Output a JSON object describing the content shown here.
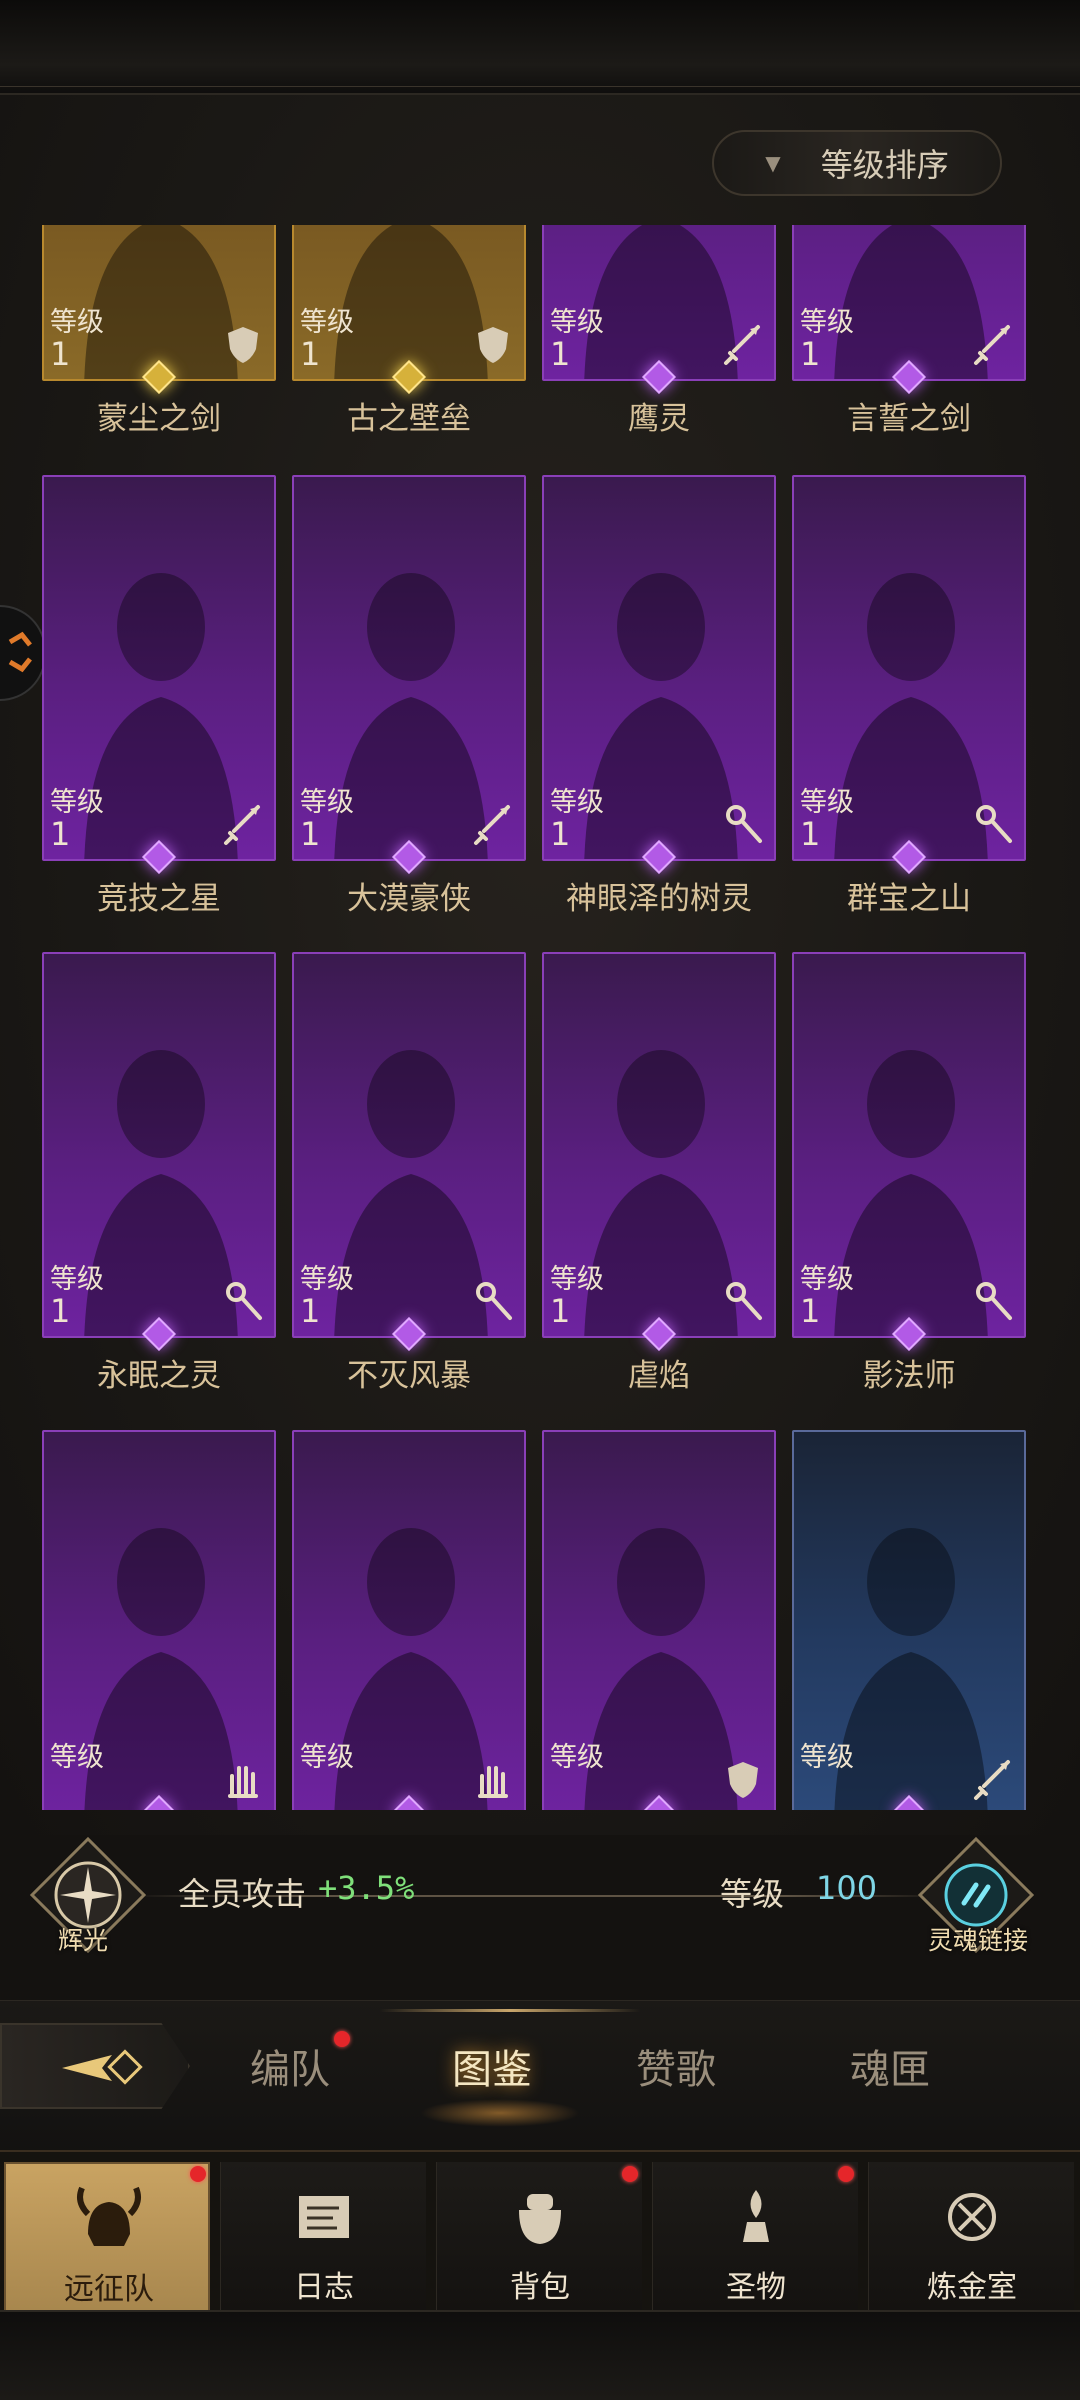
{
  "header": {
    "sort_label": "等级排序"
  },
  "level_label": "等级",
  "heroes": [
    {
      "name": "蒙尘之剑",
      "level": "1",
      "rarity": "gold",
      "class_icon": "shield-icon"
    },
    {
      "name": "古之壁垒",
      "level": "1",
      "rarity": "gold",
      "class_icon": "shield-icon"
    },
    {
      "name": "鹰灵",
      "level": "1",
      "rarity": "purple",
      "class_icon": "sword-icon"
    },
    {
      "name": "言誓之剑",
      "level": "1",
      "rarity": "purple",
      "class_icon": "sword-icon"
    },
    {
      "name": "竞技之星",
      "level": "1",
      "rarity": "purple",
      "class_icon": "sword-icon"
    },
    {
      "name": "大漠豪侠",
      "level": "1",
      "rarity": "purple",
      "class_icon": "sword-icon"
    },
    {
      "name": "神眼泽的树灵",
      "level": "1",
      "rarity": "purple",
      "class_icon": "staff-icon"
    },
    {
      "name": "群宝之山",
      "level": "1",
      "rarity": "purple",
      "class_icon": "staff-icon"
    },
    {
      "name": "永眠之灵",
      "level": "1",
      "rarity": "purple",
      "class_icon": "staff-icon"
    },
    {
      "name": "不灭风暴",
      "level": "1",
      "rarity": "purple",
      "class_icon": "staff-icon"
    },
    {
      "name": "虐焰",
      "level": "1",
      "rarity": "purple",
      "class_icon": "staff-icon"
    },
    {
      "name": "影法师",
      "level": "1",
      "rarity": "purple",
      "class_icon": "staff-icon"
    },
    {
      "name": "",
      "level": "",
      "rarity": "purple",
      "class_icon": "hand-icon"
    },
    {
      "name": "",
      "level": "",
      "rarity": "purple",
      "class_icon": "hand-icon"
    },
    {
      "name": "",
      "level": "",
      "rarity": "purple",
      "class_icon": "shield-icon"
    },
    {
      "name": "",
      "level": "",
      "rarity": "blue",
      "class_icon": "sword-icon"
    }
  ],
  "bonus": {
    "left_emblem_label": "辉光",
    "text": "全员攻击",
    "value": "+3.5%",
    "level_label": "等级",
    "level_value": "100",
    "right_emblem_label": "灵魂链接"
  },
  "tabs": [
    {
      "label": "编队",
      "active": false,
      "dot": true
    },
    {
      "label": "图鉴",
      "active": true,
      "dot": false
    },
    {
      "label": "赞歌",
      "active": false,
      "dot": false
    },
    {
      "label": "魂匣",
      "active": false,
      "dot": false
    }
  ],
  "nav": [
    {
      "label": "远征队",
      "icon": "helmet-icon",
      "active": true,
      "dot": true
    },
    {
      "label": "日志",
      "icon": "scroll-icon",
      "active": false,
      "dot": false
    },
    {
      "label": "背包",
      "icon": "bag-icon",
      "active": false,
      "dot": true
    },
    {
      "label": "圣物",
      "icon": "relic-icon",
      "active": false,
      "dot": true
    },
    {
      "label": "炼金室",
      "icon": "alchemy-icon",
      "active": false,
      "dot": false
    }
  ],
  "colors": {
    "purple_frame": "#8a3fb8",
    "gold_frame": "#b8892e",
    "accent_green": "#7fe07a",
    "accent_cyan": "#7fd6e6",
    "dot_red": "#e5262a"
  }
}
